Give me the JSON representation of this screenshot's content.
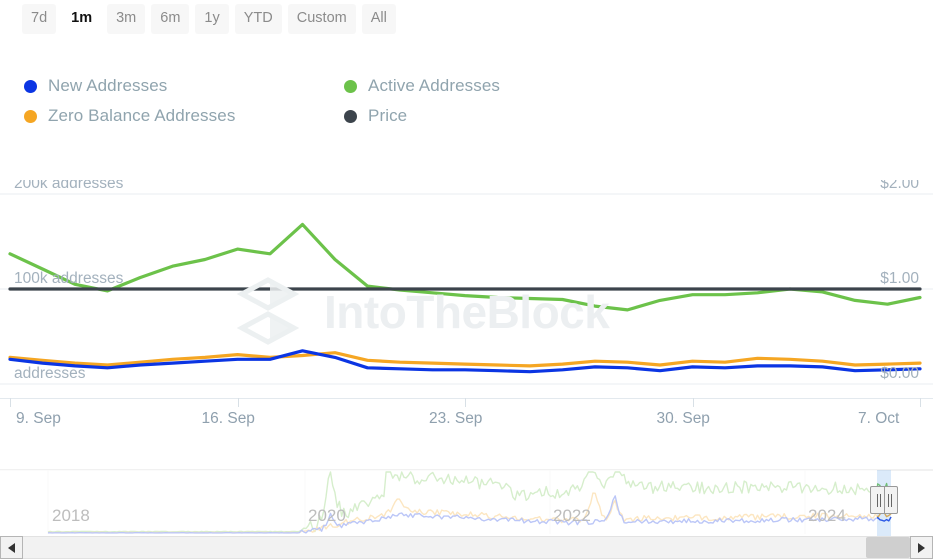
{
  "range_selector": {
    "options": [
      {
        "label": "7d",
        "active": false
      },
      {
        "label": "1m",
        "active": true
      },
      {
        "label": "3m",
        "active": false
      },
      {
        "label": "6m",
        "active": false
      },
      {
        "label": "1y",
        "active": false
      },
      {
        "label": "YTD",
        "active": false
      },
      {
        "label": "Custom",
        "active": false
      },
      {
        "label": "All",
        "active": false
      }
    ]
  },
  "legend": {
    "items": [
      {
        "label": "New Addresses",
        "color": "#0B35E3"
      },
      {
        "label": "Active Addresses",
        "color": "#6CC24A"
      },
      {
        "label": "Zero Balance Addresses",
        "color": "#F5A623"
      },
      {
        "label": "Price",
        "color": "#3C444C"
      }
    ]
  },
  "watermark": {
    "text": "IntoTheBlock"
  },
  "chart_data": {
    "type": "line",
    "title": "",
    "xlabel": "",
    "ylabel": "addresses",
    "y2label": "",
    "grid": true,
    "legend_position": "top-left",
    "x_tick_labels": [
      "9. Sep",
      "16. Sep",
      "23. Sep",
      "30. Sep",
      "7. Oct"
    ],
    "y_left_ticks": [
      "addresses",
      "100k addresses",
      "200k addresses"
    ],
    "y_left_values": [
      0,
      100000,
      200000
    ],
    "ylim": [
      0,
      200000
    ],
    "y_right_ticks": [
      "$0.00",
      "$1.00",
      "$2.00"
    ],
    "y_right_values": [
      0,
      1,
      2
    ],
    "y2lim": [
      0,
      2
    ],
    "x": [
      "9. Sep",
      "10. Sep",
      "11. Sep",
      "12. Sep",
      "13. Sep",
      "14. Sep",
      "15. Sep",
      "16. Sep",
      "17. Sep",
      "18. Sep",
      "19. Sep",
      "20. Sep",
      "21. Sep",
      "22. Sep",
      "23. Sep",
      "24. Sep",
      "25. Sep",
      "26. Sep",
      "27. Sep",
      "28. Sep",
      "29. Sep",
      "30. Sep",
      "1. Oct",
      "2. Oct",
      "3. Oct",
      "4. Oct",
      "5. Oct",
      "6. Oct",
      "7. Oct"
    ],
    "series": [
      {
        "name": "Active Addresses",
        "color": "#6CC24A",
        "axis": "left",
        "unit": "addresses",
        "values": [
          137000,
          121000,
          105000,
          98000,
          112000,
          124000,
          131000,
          142000,
          137000,
          168000,
          131000,
          103000,
          99000,
          96000,
          93000,
          91000,
          90000,
          89000,
          82000,
          78000,
          88000,
          94000,
          94000,
          96000,
          100000,
          97000,
          88000,
          84000,
          91000
        ]
      },
      {
        "name": "Zero Balance Addresses",
        "color": "#F5A623",
        "axis": "left",
        "unit": "addresses",
        "values": [
          28000,
          25000,
          22000,
          20000,
          23000,
          26000,
          28000,
          31000,
          28000,
          30000,
          33000,
          25000,
          23000,
          22000,
          21000,
          20000,
          19000,
          21000,
          24000,
          23000,
          20000,
          24000,
          23000,
          27000,
          26000,
          24000,
          20000,
          21000,
          22000
        ]
      },
      {
        "name": "New Addresses",
        "color": "#0B35E3",
        "axis": "left",
        "unit": "addresses",
        "values": [
          26000,
          22000,
          19000,
          17000,
          20000,
          22000,
          24000,
          26000,
          26000,
          35000,
          28000,
          17000,
          16000,
          15000,
          15000,
          14000,
          13000,
          15000,
          18000,
          17000,
          14000,
          18000,
          17000,
          19000,
          19000,
          18000,
          14000,
          15000,
          16000
        ]
      },
      {
        "name": "Price",
        "color": "#3C444C",
        "axis": "right",
        "unit": "USD",
        "values": [
          1.0,
          1.0,
          1.0,
          1.0,
          1.0,
          1.0,
          1.0,
          1.0,
          1.0,
          1.0,
          1.0,
          1.0,
          1.0,
          1.0,
          1.0,
          1.0,
          1.0,
          1.0,
          1.0,
          1.0,
          1.0,
          1.0,
          1.0,
          1.0,
          1.0,
          1.0,
          1.0,
          1.0,
          1.0
        ]
      }
    ]
  },
  "navigator": {
    "year_labels": [
      "2018",
      "2020",
      "2022",
      "2024"
    ],
    "selection_label": "",
    "handle_label": "navigator-handle"
  },
  "scrollbar": {
    "left_arrow_label": "scroll-left",
    "right_arrow_label": "scroll-right"
  }
}
